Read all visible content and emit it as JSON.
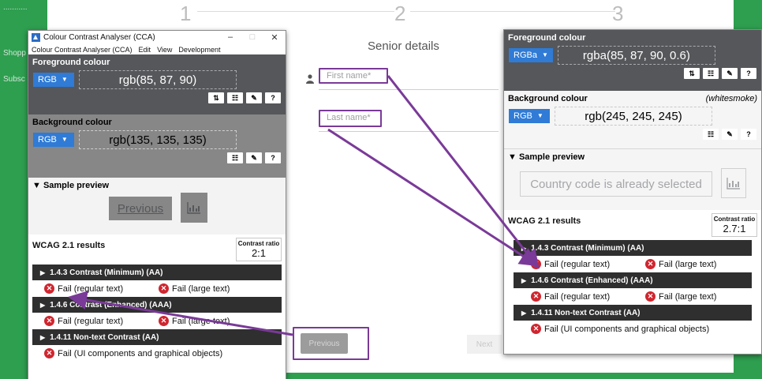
{
  "background": {
    "left_links": [
      "...........",
      "Shopp",
      "Subsc"
    ],
    "steps": [
      "1",
      "2",
      "3"
    ],
    "form_title": "Senior details",
    "first_name_placeholder": "First name*",
    "last_name_placeholder": "Last name*",
    "previous_label": "Previous",
    "next_label": "Next"
  },
  "cca_left": {
    "window_title": "Colour Contrast Analyser (CCA)",
    "menu": [
      "Colour Contrast Analyser (CCA)",
      "Edit",
      "View",
      "Development"
    ],
    "foreground": {
      "title": "Foreground colour",
      "format": "RGB",
      "value": "rgb(85, 87, 90)"
    },
    "background": {
      "title": "Background colour",
      "format": "RGB",
      "value": "rgb(135, 135, 135)"
    },
    "preview": {
      "title": "▼ Sample preview",
      "text": "Previous"
    },
    "results": {
      "title": "WCAG 2.1 results",
      "ratio_label": "Contrast ratio",
      "ratio": "2:1",
      "criteria": [
        {
          "name": "1.4.3 Contrast (Minimum) (AA)",
          "fails": [
            "Fail (regular text)",
            "Fail (large text)"
          ]
        },
        {
          "name": "1.4.6 Contrast (Enhanced) (AAA)",
          "fails": [
            "Fail (regular text)",
            "Fail (large text)"
          ]
        },
        {
          "name": "1.4.11 Non-text Contrast (AA)",
          "fails": [
            "Fail (UI components and graphical objects)"
          ]
        }
      ]
    }
  },
  "cca_right": {
    "foreground": {
      "title": "Foreground colour",
      "format": "RGBa",
      "value": "rgba(85, 87, 90, 0.6)"
    },
    "background": {
      "title": "Background colour",
      "aside": "(whitesmoke)",
      "format": "RGB",
      "value": "rgb(245, 245, 245)"
    },
    "preview": {
      "title": "▼ Sample preview",
      "text": "Country code is already selected"
    },
    "results": {
      "title": "WCAG 2.1 results",
      "ratio_label": "Contrast ratio",
      "ratio": "2.7:1",
      "criteria": [
        {
          "name": "1.4.3 Contrast (Minimum) (AA)",
          "fails": [
            "Fail (regular text)",
            "Fail (large text)"
          ]
        },
        {
          "name": "1.4.6 Contrast (Enhanced) (AAA)",
          "fails": [
            "Fail (regular text)",
            "Fail (large text)"
          ]
        },
        {
          "name": "1.4.11 Non-text Contrast (AA)",
          "fails": [
            "Fail (UI components and graphical objects)"
          ]
        }
      ]
    }
  },
  "colors": {
    "annotation": "#7a3a98",
    "fail": "#d0262f",
    "select": "#2f7bd6",
    "brand_green": "#2e9e4f"
  }
}
